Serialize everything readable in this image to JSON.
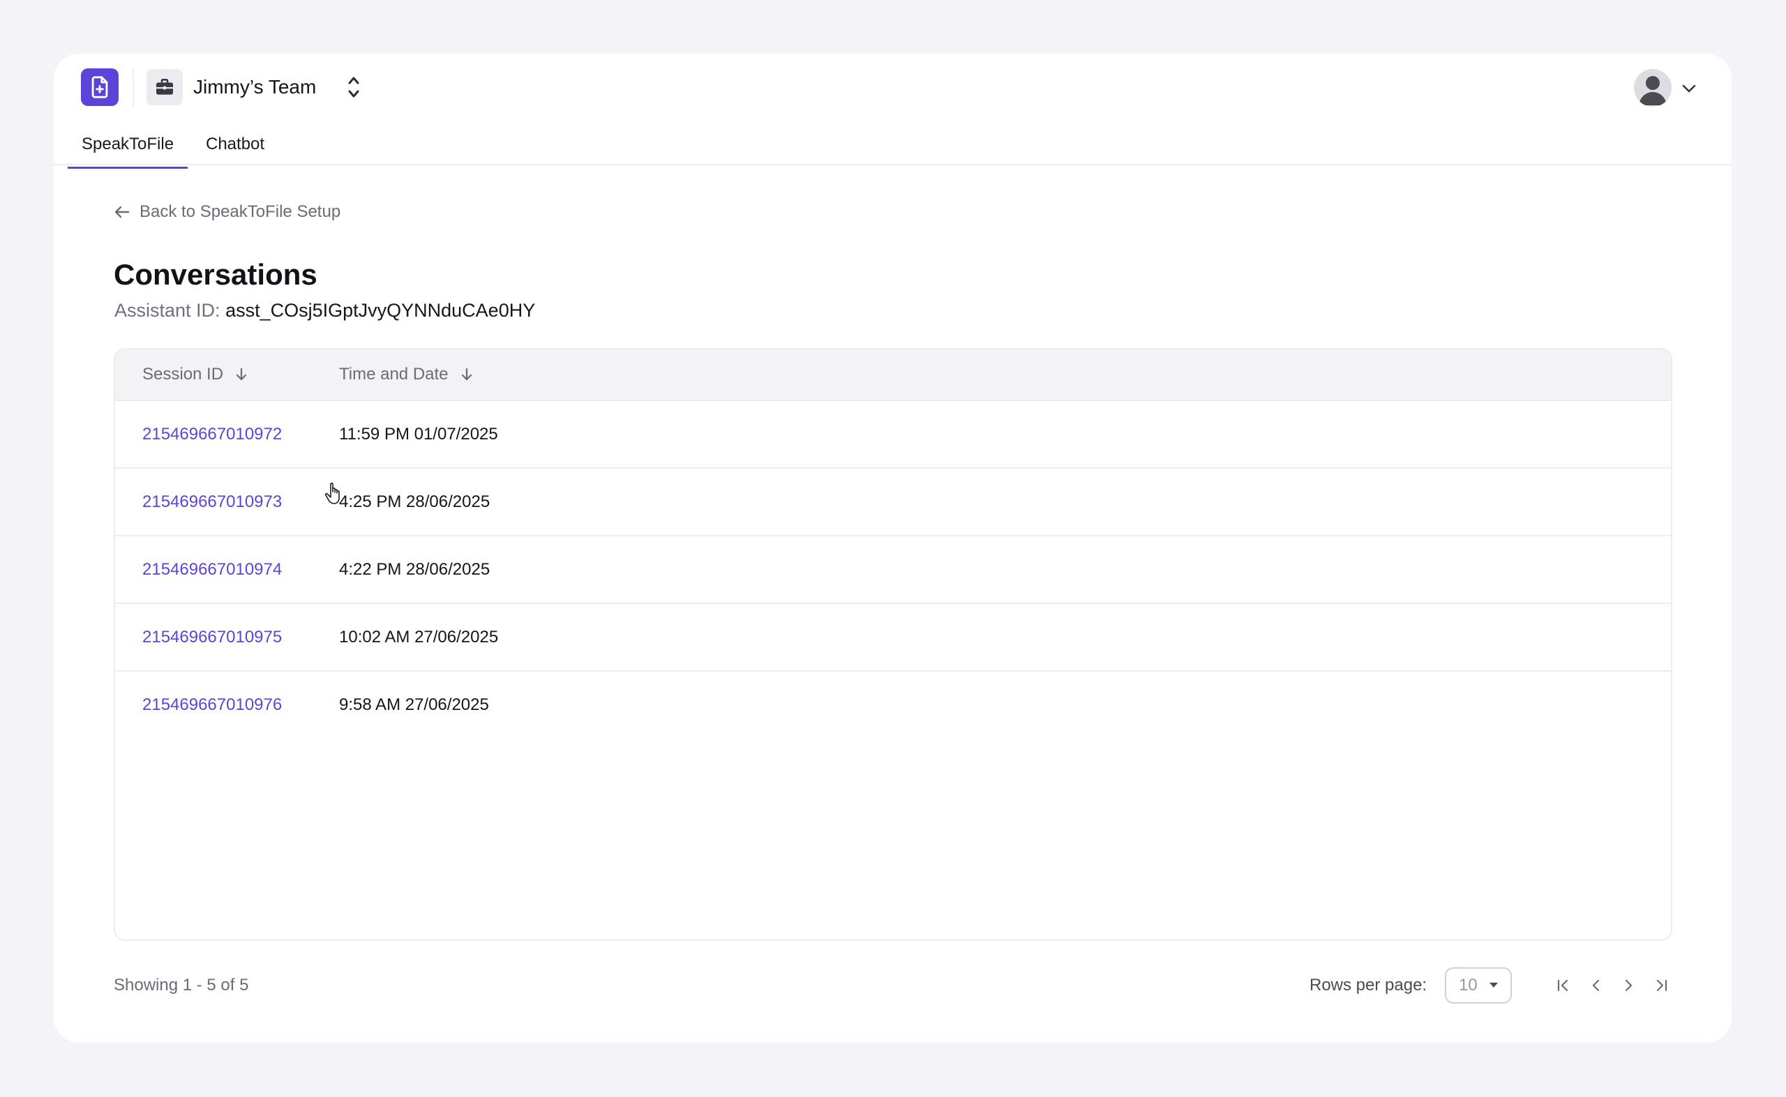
{
  "header": {
    "team_name": "Jimmy’s Team",
    "app_logo_icon": "file-plus-icon",
    "team_icon": "briefcase-icon",
    "accent_color": "#5b45d8"
  },
  "tabs": [
    {
      "label": "SpeakToFile",
      "active": true
    },
    {
      "label": "Chatbot",
      "active": false
    }
  ],
  "main": {
    "back_label": "Back to SpeakToFile Setup",
    "title": "Conversations",
    "assistant_label": "Assistant ID:",
    "assistant_id": "asst_COsj5IGptJvyQYNNduCAe0HY"
  },
  "table": {
    "columns": [
      "Session ID",
      "Time and Date"
    ],
    "rows": [
      {
        "session_id": "215469667010972",
        "datetime": "11:59 PM 01/07/2025"
      },
      {
        "session_id": "215469667010973",
        "datetime": "4:25 PM 28/06/2025"
      },
      {
        "session_id": "215469667010974",
        "datetime": "4:22 PM 28/06/2025"
      },
      {
        "session_id": "215469667010975",
        "datetime": "10:02 AM 27/06/2025"
      },
      {
        "session_id": "215469667010976",
        "datetime": "9:58 AM 27/06/2025"
      }
    ]
  },
  "footer": {
    "showing": "Showing 1 - 5 of 5",
    "rows_per_page_label": "Rows per page:",
    "rows_per_page_value": "10"
  }
}
